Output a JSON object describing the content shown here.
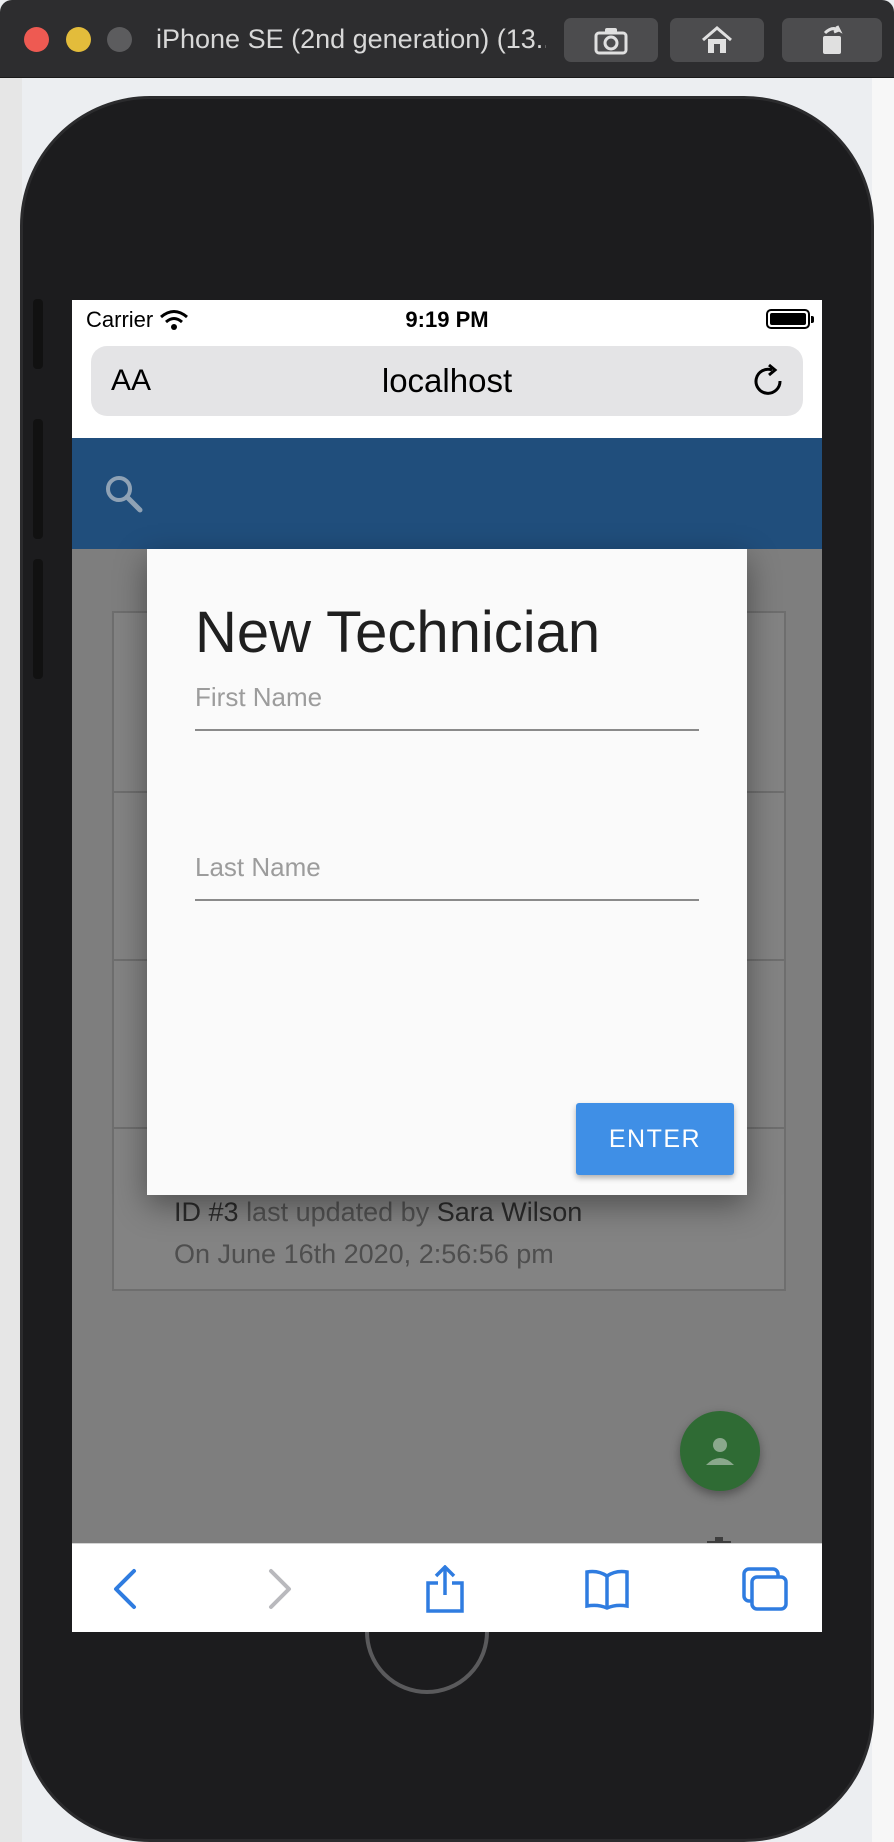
{
  "simulator": {
    "title": "iPhone SE (2nd generation) (13...",
    "buttons": [
      "screenshot",
      "home",
      "rotate"
    ]
  },
  "status_bar": {
    "carrier": "Carrier",
    "time": "9:19 PM"
  },
  "address_bar": {
    "text_size_label": "AA",
    "url": "localhost"
  },
  "list": {
    "rows": [
      {
        "id": "",
        "updated_by_label": "",
        "name": "",
        "date": ""
      },
      {
        "id": "",
        "updated_by_label": "",
        "name": "",
        "date": ""
      },
      {
        "id": "",
        "updated_by_label": "",
        "name": "",
        "date": ""
      },
      {
        "id": "ID #3",
        "updated_by_label": "last updated by",
        "name": "Sara Wilson",
        "date": "On June 16th 2020, 2:56:56 pm"
      }
    ]
  },
  "dialog": {
    "title": "New Technician",
    "first_name_placeholder": "First Name",
    "last_name_placeholder": "Last Name",
    "first_name_value": "",
    "last_name_value": "",
    "enter_label": "ENTER"
  },
  "fabs": {
    "add_label": "+"
  },
  "colors": {
    "header": "#204e7c",
    "enter_button": "#3f8fe6",
    "fab_green": "#2f6b34",
    "fab_red": "#8a2f29",
    "fab_blue": "#1d4c7c"
  },
  "bottom_bar": {
    "icons": [
      "back-icon",
      "forward-icon",
      "share-icon",
      "bookmarks-icon",
      "tabs-icon"
    ]
  }
}
